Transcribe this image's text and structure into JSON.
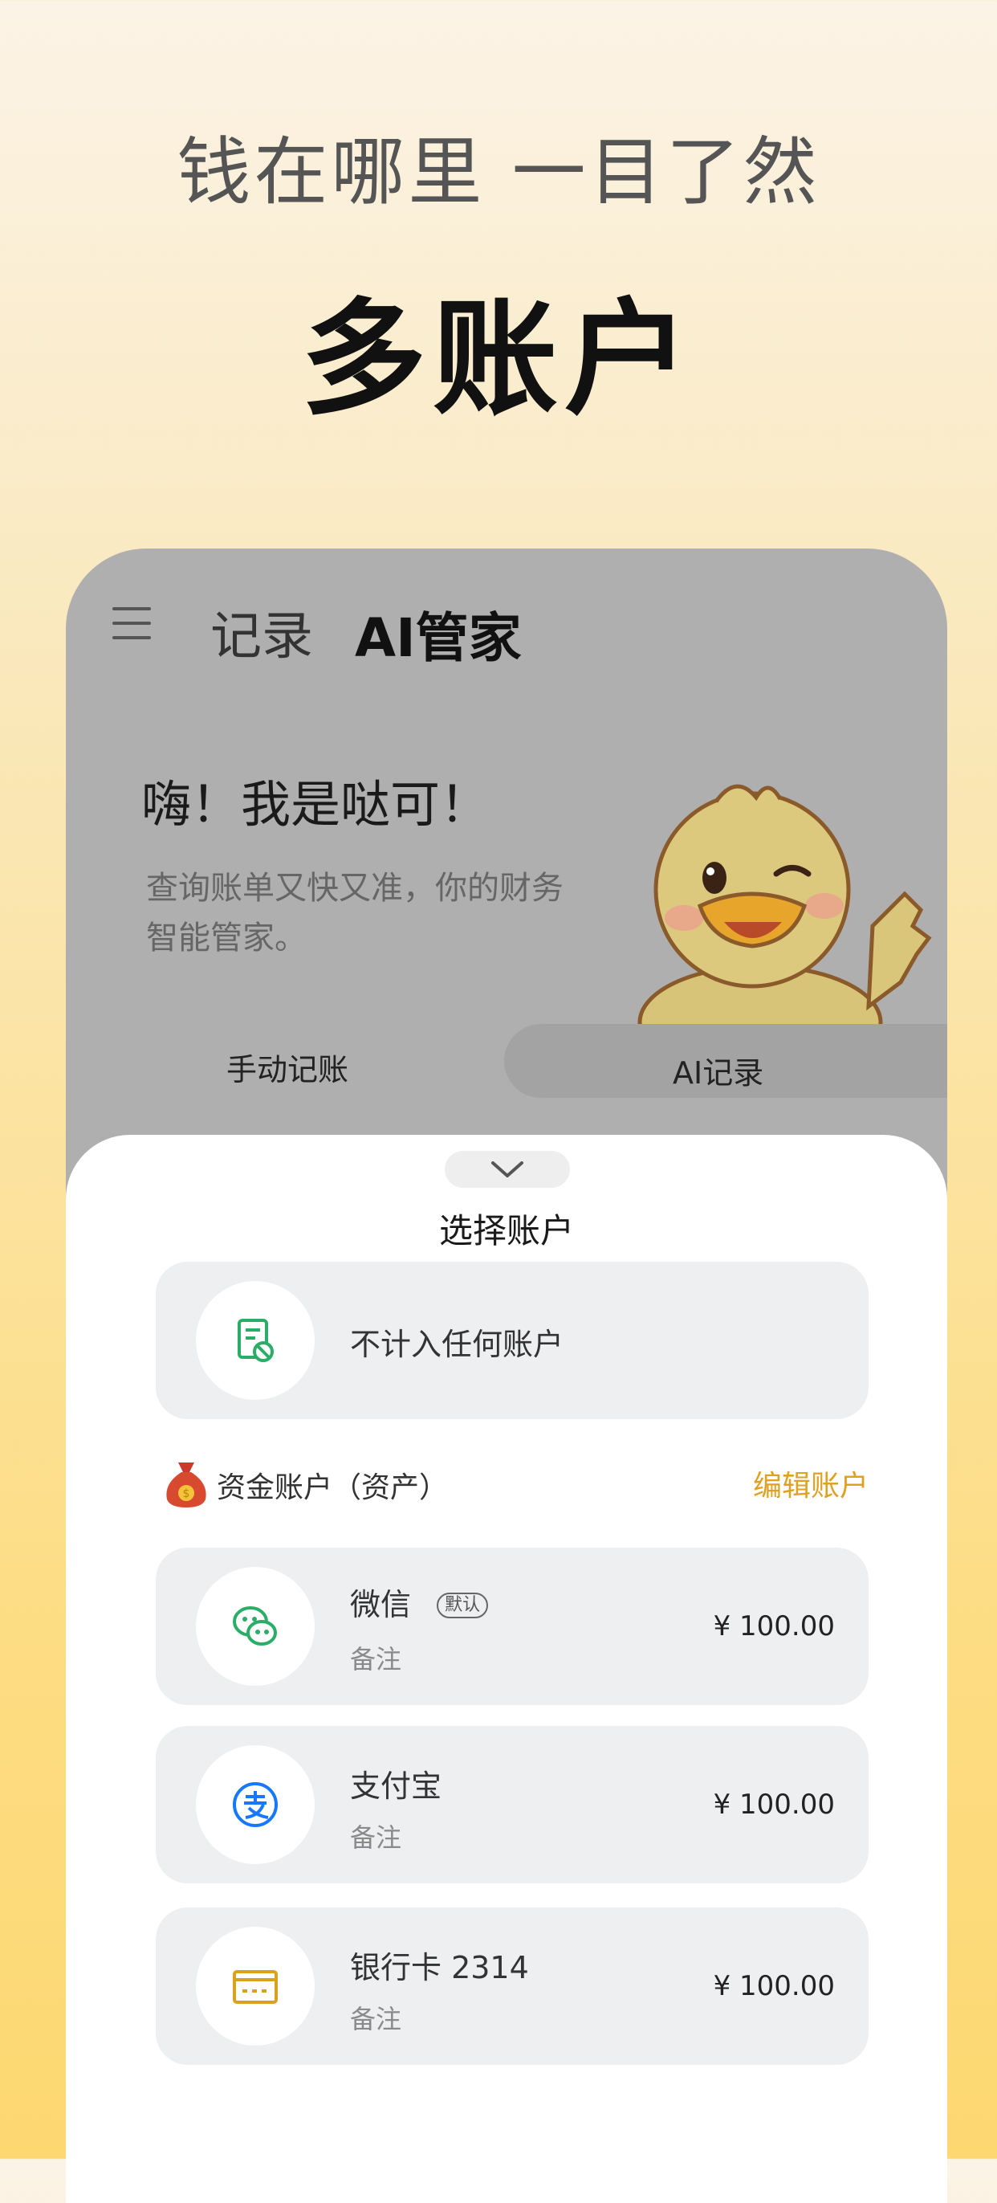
{
  "headline": {
    "subtitle": "钱在哪里 一目了然",
    "title": "多账户"
  },
  "app": {
    "tabs": [
      {
        "label": "记录",
        "active": false
      },
      {
        "label": "AI管家",
        "active": true
      }
    ],
    "greeting": {
      "title": "嗨！我是哒可！",
      "description": "查询账单又快又准，你的财务智能管家。"
    },
    "mode_tabs": [
      {
        "label": "手动记账",
        "active": true
      },
      {
        "label": "AI记录",
        "active": false
      }
    ]
  },
  "sheet": {
    "title": "选择账户",
    "no_account": {
      "label": "不计入任何账户",
      "icon": "document-ban-icon"
    },
    "section": {
      "label": "资金账户（资产）",
      "icon": "money-bag-icon",
      "edit_label": "编辑账户"
    },
    "accounts": [
      {
        "name": "微信",
        "badge": "默认",
        "note": "备注",
        "amount": "¥ 100.00",
        "icon": "wechat-icon",
        "color": "#2aae67"
      },
      {
        "name": "支付宝",
        "note": "备注",
        "amount": "¥ 100.00",
        "icon": "alipay-icon",
        "color": "#1677ff"
      },
      {
        "name": "银行卡 2314",
        "note": "备注",
        "amount": "¥ 100.00",
        "icon": "bank-card-icon",
        "color": "#d9a21c"
      }
    ]
  },
  "colors": {
    "accent": "#e0a020",
    "green": "#2aae67",
    "blue": "#1677ff"
  }
}
